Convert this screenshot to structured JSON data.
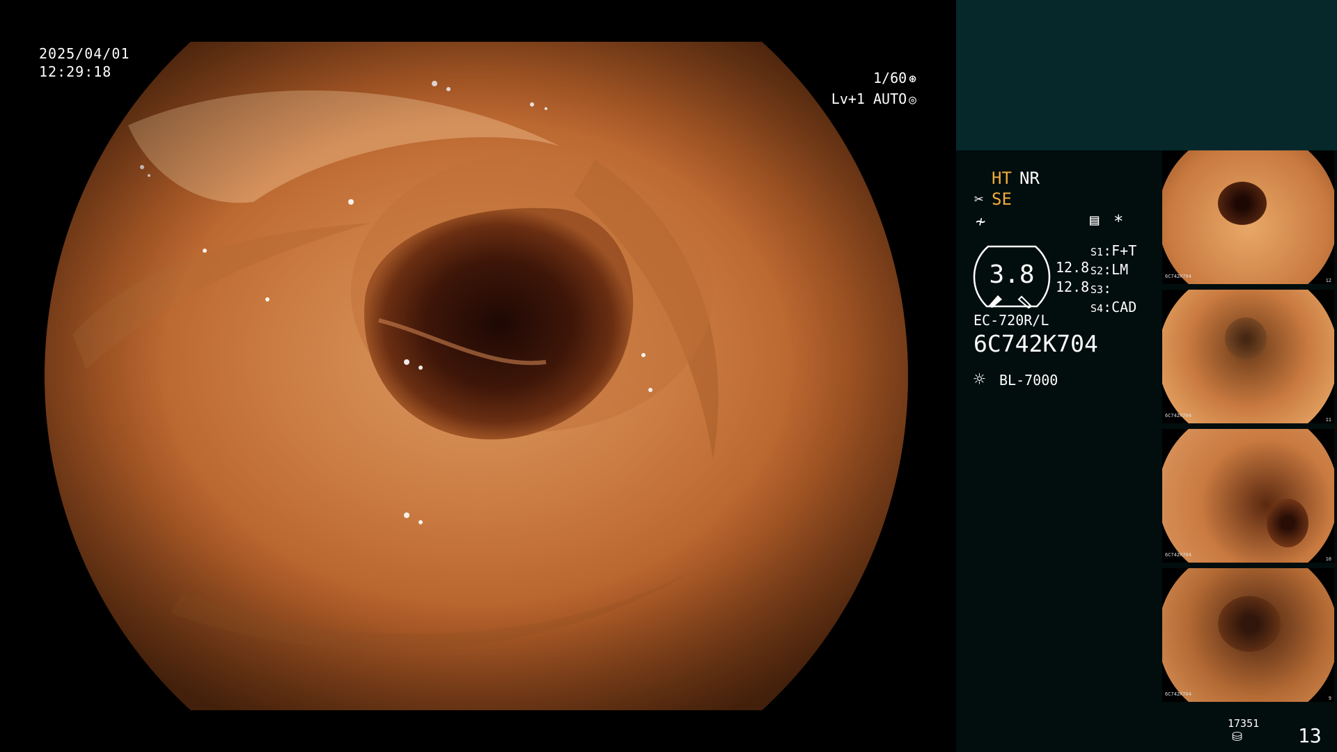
{
  "screen": {
    "date": "2025/04/01",
    "time": "12:29:18",
    "shutter": "1/60",
    "shutter_icon": "aperture-icon",
    "mode": "Lv+1 AUTO",
    "mode_icon": "auto-iris-icon"
  },
  "processor": {
    "ht": "HT",
    "nr": "NR",
    "se": "SE",
    "se_icon": "scissors-icon",
    "noise_icon": "noise-reduction-icon",
    "menu_icon": "menu-icon",
    "star_icon": "asterisk-icon",
    "gauge_value": "3.8",
    "values": [
      "12.8",
      "12.8"
    ],
    "settings": [
      {
        "key": "S1",
        "value": "F+T"
      },
      {
        "key": "S2",
        "value": "LM"
      },
      {
        "key": "S3",
        "value": ""
      },
      {
        "key": "S4",
        "value": "CAD"
      }
    ],
    "scope_model": "EC-720R/L",
    "serial": "6C742K704",
    "lamp_icon": "light-source-icon",
    "light_source": "BL-7000",
    "storage_count": "17351",
    "storage_icon": "database-icon",
    "image_counter": "13"
  },
  "thumbnails": [
    {
      "id_text": "6C742K704",
      "counter": "12"
    },
    {
      "id_text": "6C742K704",
      "counter": "11"
    },
    {
      "id_text": "6C742K704",
      "counter": "10"
    },
    {
      "id_text": "6C742K704",
      "counter": "9"
    }
  ],
  "colors": {
    "accent_orange": "#f0ac3a",
    "panel_top": "#06282a",
    "panel_bg": "#020d0d",
    "mucosa": "#c97a40"
  }
}
